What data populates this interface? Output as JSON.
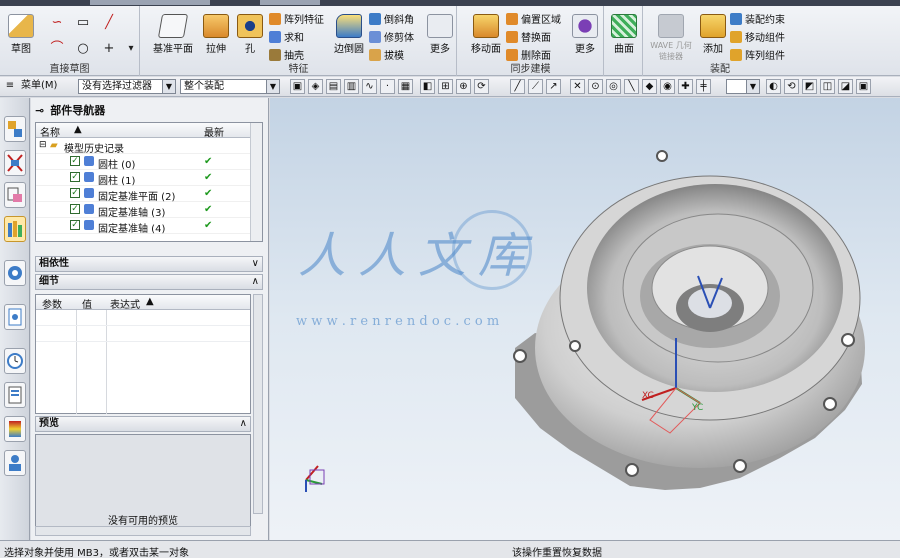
{
  "ribbon": {
    "groups": {
      "sketch": "直接草图",
      "feature": "特征",
      "sync": "同步建模",
      "assembly": "装配"
    },
    "buttons": {
      "sketch": "草图",
      "datum_plane": "基准平面",
      "extrude": "拉伸",
      "hole": "孔",
      "pattern_feature": "阵列特征",
      "unite": "求和",
      "shell": "抽壳",
      "edge_blend": "边倒圆",
      "chamfer": "倒斜角",
      "trim_body": "修剪体",
      "draft": "拔模",
      "more_feature": "更多",
      "move_face": "移动面",
      "offset_region": "偏置区域",
      "replace_face": "替换面",
      "delete_face": "删除面",
      "more_sync": "更多",
      "surface": "曲面",
      "wave_geometry": "WAVE 几何链接器",
      "add": "添加",
      "assembly_constraints": "装配约束",
      "move_component": "移动组件",
      "pattern_component": "阵列组件"
    }
  },
  "toolbar2": {
    "menu_label": "菜单(M)",
    "filter_placeholder": "没有选择过滤器",
    "scope": "整个装配"
  },
  "navigator": {
    "title": "部件导航器",
    "columns": {
      "name": "名称",
      "latest": "最新"
    },
    "rows": [
      {
        "label": "模型历史记录",
        "indent": 0,
        "ok": false
      },
      {
        "label": "圆柱 (0)",
        "indent": 1,
        "ok": true
      },
      {
        "label": "圆柱 (1)",
        "indent": 1,
        "ok": true
      },
      {
        "label": "固定基准平面 (2)",
        "indent": 1,
        "ok": true
      },
      {
        "label": "固定基准轴 (3)",
        "indent": 1,
        "ok": true
      },
      {
        "label": "固定基准轴 (4)",
        "indent": 1,
        "ok": true
      }
    ],
    "dependencies": "相依性",
    "details": "细节",
    "detail_columns": {
      "param": "参数",
      "value": "值",
      "expression": "表达式"
    },
    "preview": "预览",
    "preview_empty": "没有可用的预览"
  },
  "watermark": {
    "title": "人人文库",
    "url": "w w w . r e n r e n d o c . c o m"
  },
  "status": {
    "left": "选择对象并使用 MB3，或者双击某一对象",
    "right": "该操作重置恢复数据"
  },
  "colors": {
    "viewport_top": "#c3d3e4",
    "viewport_bottom": "#eef2f7",
    "watermark": "#4a86c9",
    "ok_green": "#1f9a1f"
  }
}
